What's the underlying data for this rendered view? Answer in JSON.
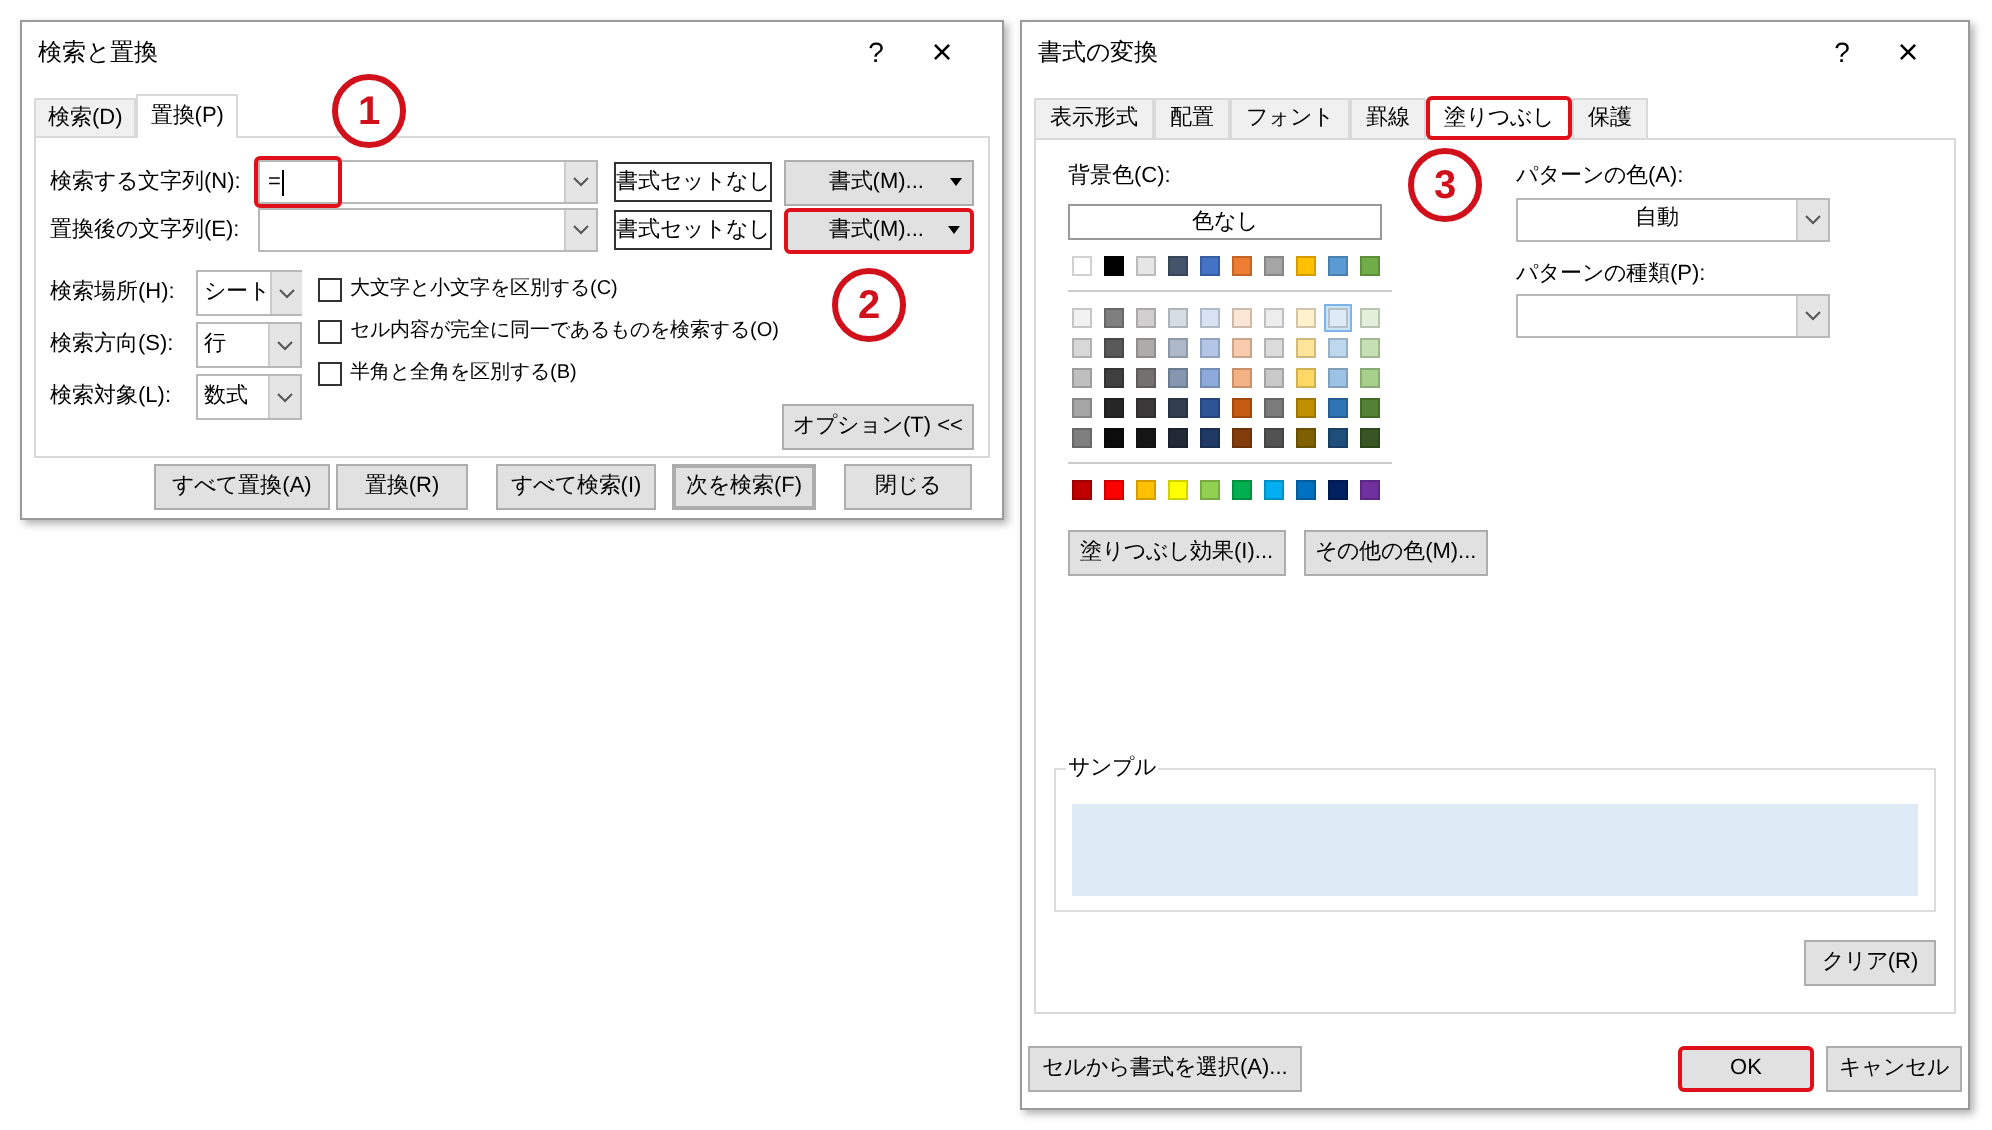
{
  "annotations": [
    {
      "label": "1"
    },
    {
      "label": "2"
    },
    {
      "label": "3"
    }
  ],
  "find_replace": {
    "title": "検索と置換",
    "help": "?",
    "close": "×",
    "tabs": [
      {
        "label": "検索(D)",
        "selected": false
      },
      {
        "label": "置換(P)",
        "selected": true
      }
    ],
    "rows": [
      {
        "label": "検索する文字列(N):",
        "value": "=",
        "highlighted": true,
        "no_format": "書式セットなし",
        "format_button": {
          "label": "書式(M)...",
          "highlighted": false
        }
      },
      {
        "label": "置換後の文字列(E):",
        "highlighted": false,
        "no_format": "書式セットなし",
        "format_button": {
          "label": "書式(M)...",
          "highlighted": true
        }
      }
    ],
    "selects": [
      {
        "label": "検索場所(H):",
        "value": "シート"
      },
      {
        "label": "検索方向(S):",
        "value": "行"
      },
      {
        "label": "検索対象(L):",
        "value": "数式"
      }
    ],
    "checkboxes": [
      {
        "label": "大文字と小文字を区別する(C)",
        "checked": false
      },
      {
        "label": "セル内容が完全に同一であるものを検索する(O)",
        "checked": false
      },
      {
        "label": "半角と全角を区別する(B)",
        "checked": false
      }
    ],
    "options_button": "オプション(T) <<",
    "buttons": [
      {
        "label": "すべて置換(A)",
        "default": false
      },
      {
        "label": "置換(R)",
        "default": false
      },
      {
        "label": "すべて検索(I)",
        "default": false
      },
      {
        "label": "次を検索(F)",
        "default": true
      },
      {
        "label": "閉じる",
        "default": false
      }
    ]
  },
  "format_dialog": {
    "title": "書式の変換",
    "help": "?",
    "close": "×",
    "tabs": [
      {
        "label": "表示形式",
        "selected": false,
        "highlighted": false
      },
      {
        "label": "配置",
        "selected": false,
        "highlighted": false
      },
      {
        "label": "フォント",
        "selected": false,
        "highlighted": false
      },
      {
        "label": "罫線",
        "selected": false,
        "highlighted": false
      },
      {
        "label": "塗りつぶし",
        "selected": true,
        "highlighted": true
      },
      {
        "label": "保護",
        "selected": false,
        "highlighted": false
      }
    ],
    "background_label": "背景色(C):",
    "no_color_button": "色なし",
    "palette_rows": [
      {
        "kind": "theme",
        "swatches": [
          {
            "color": "#ffffff",
            "selected": false
          },
          {
            "color": "#000000",
            "selected": false
          },
          {
            "color": "#e7e6e6",
            "selected": false
          },
          {
            "color": "#44546a",
            "selected": false
          },
          {
            "color": "#4472c4",
            "selected": false
          },
          {
            "color": "#ed7d31",
            "selected": false
          },
          {
            "color": "#a5a5a5",
            "selected": false
          },
          {
            "color": "#ffc000",
            "selected": false
          },
          {
            "color": "#5b9bd5",
            "selected": false
          },
          {
            "color": "#70ad47",
            "selected": false
          }
        ]
      },
      {
        "kind": "tint",
        "swatches": [
          {
            "color": "#f2f2f2",
            "selected": false
          },
          {
            "color": "#7f7f7f",
            "selected": false
          },
          {
            "color": "#d0cece",
            "selected": false
          },
          {
            "color": "#d6dce4",
            "selected": false
          },
          {
            "color": "#d9e2f3",
            "selected": false
          },
          {
            "color": "#fbe5d5",
            "selected": false
          },
          {
            "color": "#ededed",
            "selected": false
          },
          {
            "color": "#fff2cc",
            "selected": false
          },
          {
            "color": "#deebf6",
            "selected": true
          },
          {
            "color": "#e2efd9",
            "selected": false
          }
        ]
      },
      {
        "kind": "tint",
        "swatches": [
          {
            "color": "#d8d8d8",
            "selected": false
          },
          {
            "color": "#595959",
            "selected": false
          },
          {
            "color": "#aeabab",
            "selected": false
          },
          {
            "color": "#adb9ca",
            "selected": false
          },
          {
            "color": "#b4c6e7",
            "selected": false
          },
          {
            "color": "#f7cbac",
            "selected": false
          },
          {
            "color": "#dbdbdb",
            "selected": false
          },
          {
            "color": "#fee599",
            "selected": false
          },
          {
            "color": "#bdd7ee",
            "selected": false
          },
          {
            "color": "#c5e0b3",
            "selected": false
          }
        ]
      },
      {
        "kind": "tint",
        "swatches": [
          {
            "color": "#bfbfbf",
            "selected": false
          },
          {
            "color": "#3f3f3f",
            "selected": false
          },
          {
            "color": "#757070",
            "selected": false
          },
          {
            "color": "#8496b0",
            "selected": false
          },
          {
            "color": "#8eaadb",
            "selected": false
          },
          {
            "color": "#f4b183",
            "selected": false
          },
          {
            "color": "#c9c9c9",
            "selected": false
          },
          {
            "color": "#ffd965",
            "selected": false
          },
          {
            "color": "#9cc3e5",
            "selected": false
          },
          {
            "color": "#a8d08d",
            "selected": false
          }
        ]
      },
      {
        "kind": "tint",
        "swatches": [
          {
            "color": "#a5a5a5",
            "selected": false
          },
          {
            "color": "#262626",
            "selected": false
          },
          {
            "color": "#3a3838",
            "selected": false
          },
          {
            "color": "#323f4f",
            "selected": false
          },
          {
            "color": "#2f5496",
            "selected": false
          },
          {
            "color": "#c55a11",
            "selected": false
          },
          {
            "color": "#7b7b7b",
            "selected": false
          },
          {
            "color": "#bf9000",
            "selected": false
          },
          {
            "color": "#2e75b5",
            "selected": false
          },
          {
            "color": "#538135",
            "selected": false
          }
        ]
      },
      {
        "kind": "tint",
        "swatches": [
          {
            "color": "#7f7f7f",
            "selected": false
          },
          {
            "color": "#0c0c0c",
            "selected": false
          },
          {
            "color": "#171616",
            "selected": false
          },
          {
            "color": "#222a35",
            "selected": false
          },
          {
            "color": "#1f3864",
            "selected": false
          },
          {
            "color": "#833c0b",
            "selected": false
          },
          {
            "color": "#525252",
            "selected": false
          },
          {
            "color": "#7f6000",
            "selected": false
          },
          {
            "color": "#1e4e79",
            "selected": false
          },
          {
            "color": "#375623",
            "selected": false
          }
        ]
      },
      {
        "kind": "standard",
        "swatches": [
          {
            "color": "#c00000",
            "selected": false
          },
          {
            "color": "#ff0000",
            "selected": false
          },
          {
            "color": "#ffc000",
            "selected": false
          },
          {
            "color": "#ffff00",
            "selected": false
          },
          {
            "color": "#92d050",
            "selected": false
          },
          {
            "color": "#00b050",
            "selected": false
          },
          {
            "color": "#00b0f0",
            "selected": false
          },
          {
            "color": "#0070c0",
            "selected": false
          },
          {
            "color": "#002060",
            "selected": false
          },
          {
            "color": "#7030a0",
            "selected": false
          }
        ]
      }
    ],
    "fill_buttons": [
      "塗りつぶし効果(I)...",
      "その他の色(M)..."
    ],
    "pattern_color": {
      "label": "パターンの色(A):",
      "value": "自動"
    },
    "pattern_style": {
      "label": "パターンの種類(P):"
    },
    "sample_label": "サンプル",
    "clear_button": "クリア(R)",
    "footer_left": "セルから書式を選択(A)...",
    "footer_buttons": [
      {
        "label": "OK",
        "highlighted": true
      },
      {
        "label": "キャンセル",
        "highlighted": false
      }
    ]
  }
}
